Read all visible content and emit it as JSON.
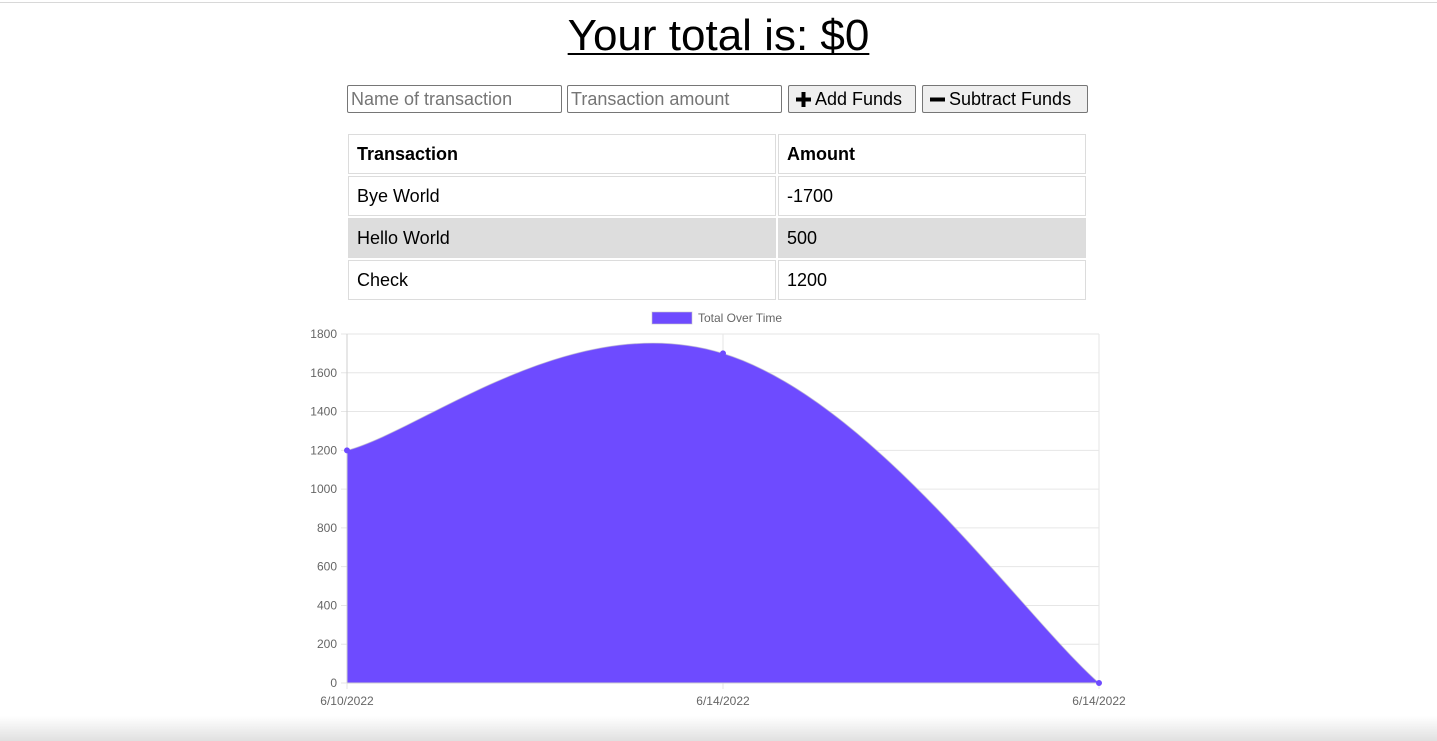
{
  "header": {
    "total_text": "Your total is: $0"
  },
  "form": {
    "name_placeholder": "Name of transaction",
    "amount_placeholder": "Transaction amount",
    "add_label": "Add Funds",
    "subtract_label": "Subtract Funds"
  },
  "table": {
    "headers": [
      "Transaction",
      "Amount"
    ],
    "rows": [
      {
        "name": "Bye World",
        "amount": "-1700"
      },
      {
        "name": "Hello World",
        "amount": "500"
      },
      {
        "name": "Check",
        "amount": "1200"
      }
    ]
  },
  "chart_data": {
    "type": "area",
    "x": [
      "6/10/2022",
      "6/14/2022",
      "6/14/2022"
    ],
    "series": [
      {
        "name": "Total Over Time",
        "values": [
          1200,
          1700,
          0
        ],
        "color": "#6e4bff"
      }
    ],
    "ylim": [
      0,
      1800
    ],
    "yticks": [
      0,
      200,
      400,
      600,
      800,
      1000,
      1200,
      1400,
      1600,
      1800
    ],
    "grid": true,
    "legend": "top-center"
  }
}
